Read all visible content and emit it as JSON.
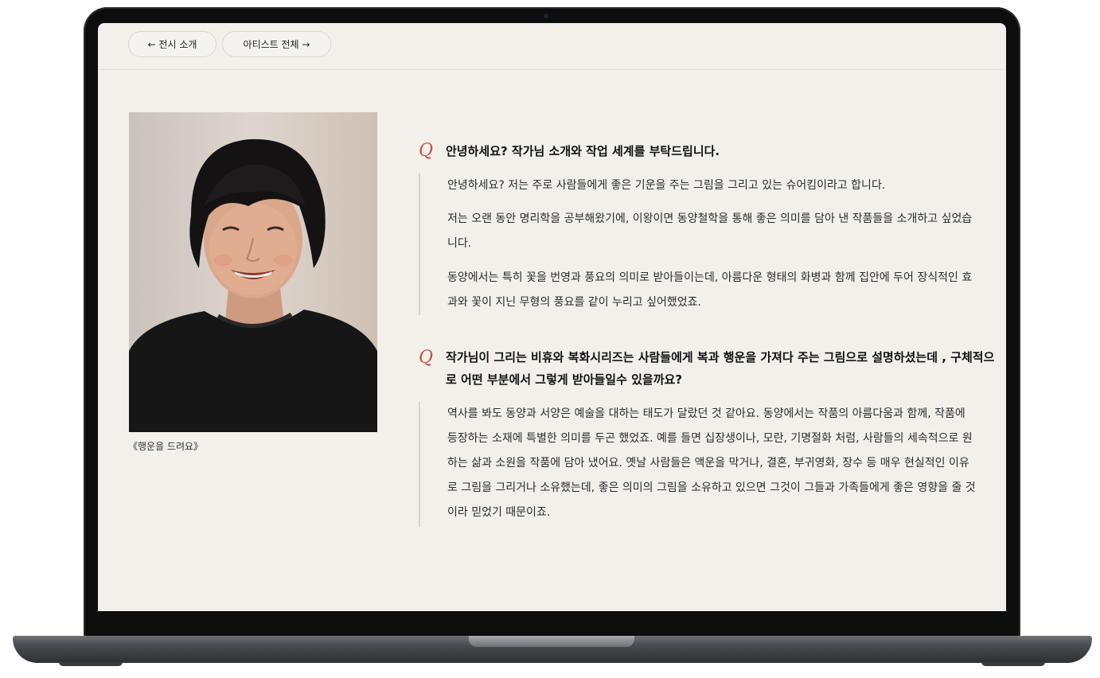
{
  "nav": {
    "back_label": "← 전시 소개",
    "all_artists_label": "아티스트 전체 →"
  },
  "artwork": {
    "caption": "《행운을 드려요》"
  },
  "interview": [
    {
      "mark": "Q",
      "question": "안녕하세요? 작가님 소개와 작업 세계를 부탁드립니다.",
      "answers": [
        "안녕하세요? 저는 주로 사람들에게 좋은 기운을 주는 그림을 그리고 있는 슈어킴이라고 합니다.",
        "저는 오랜 동안 명리학을 공부해왔기에, 이왕이면 동양철학을 통해 좋은 의미를 담아 낸 작품들을 소개하고 싶었습니다.",
        "동양에서는 특히 꽃을 번영과 풍요의 의미로 받아들이는데, 아름다운 형태의 화병과 함께 집안에 두어 장식적인 효과와 꽃이 지닌 무형의 풍요를 같이 누리고 싶어했었죠."
      ]
    },
    {
      "mark": "Q",
      "question": "작가님이 그리는 비휴와 복화시리즈는 사람들에게 복과 행운을 가져다 주는 그림으로 설명하셨는데 , 구체적으로 어떤 부분에서 그렇게 받아들일수 있을까요?",
      "answers": [
        "역사를 봐도 동양과 서양은 예술을 대하는 태도가 달랐던 것 같아요. 동양에서는 작품의 아름다움과 함께, 작품에 등장하는 소재에 특별한 의미를 두곤 했었죠. 예를 들면 십장생이나, 모란, 기명절화 처럼, 사람들의 세속적으로 원하는 삶과 소원을 작품에 담아 냈어요. 옛날 사람들은 액운을 막거나, 결혼, 부귀영화, 장수 등 매우 현실적인 이유로 그림을 그리거나 소유했는데, 좋은 의미의 그림을 소유하고 있으면 그것이 그들과 가족들에게 좋은 영향을 줄 것이라 믿었기 때문이죠."
      ]
    }
  ],
  "colors": {
    "background": "#f3f0ec",
    "accent": "#c4553a",
    "text": "#2b2b2b"
  }
}
